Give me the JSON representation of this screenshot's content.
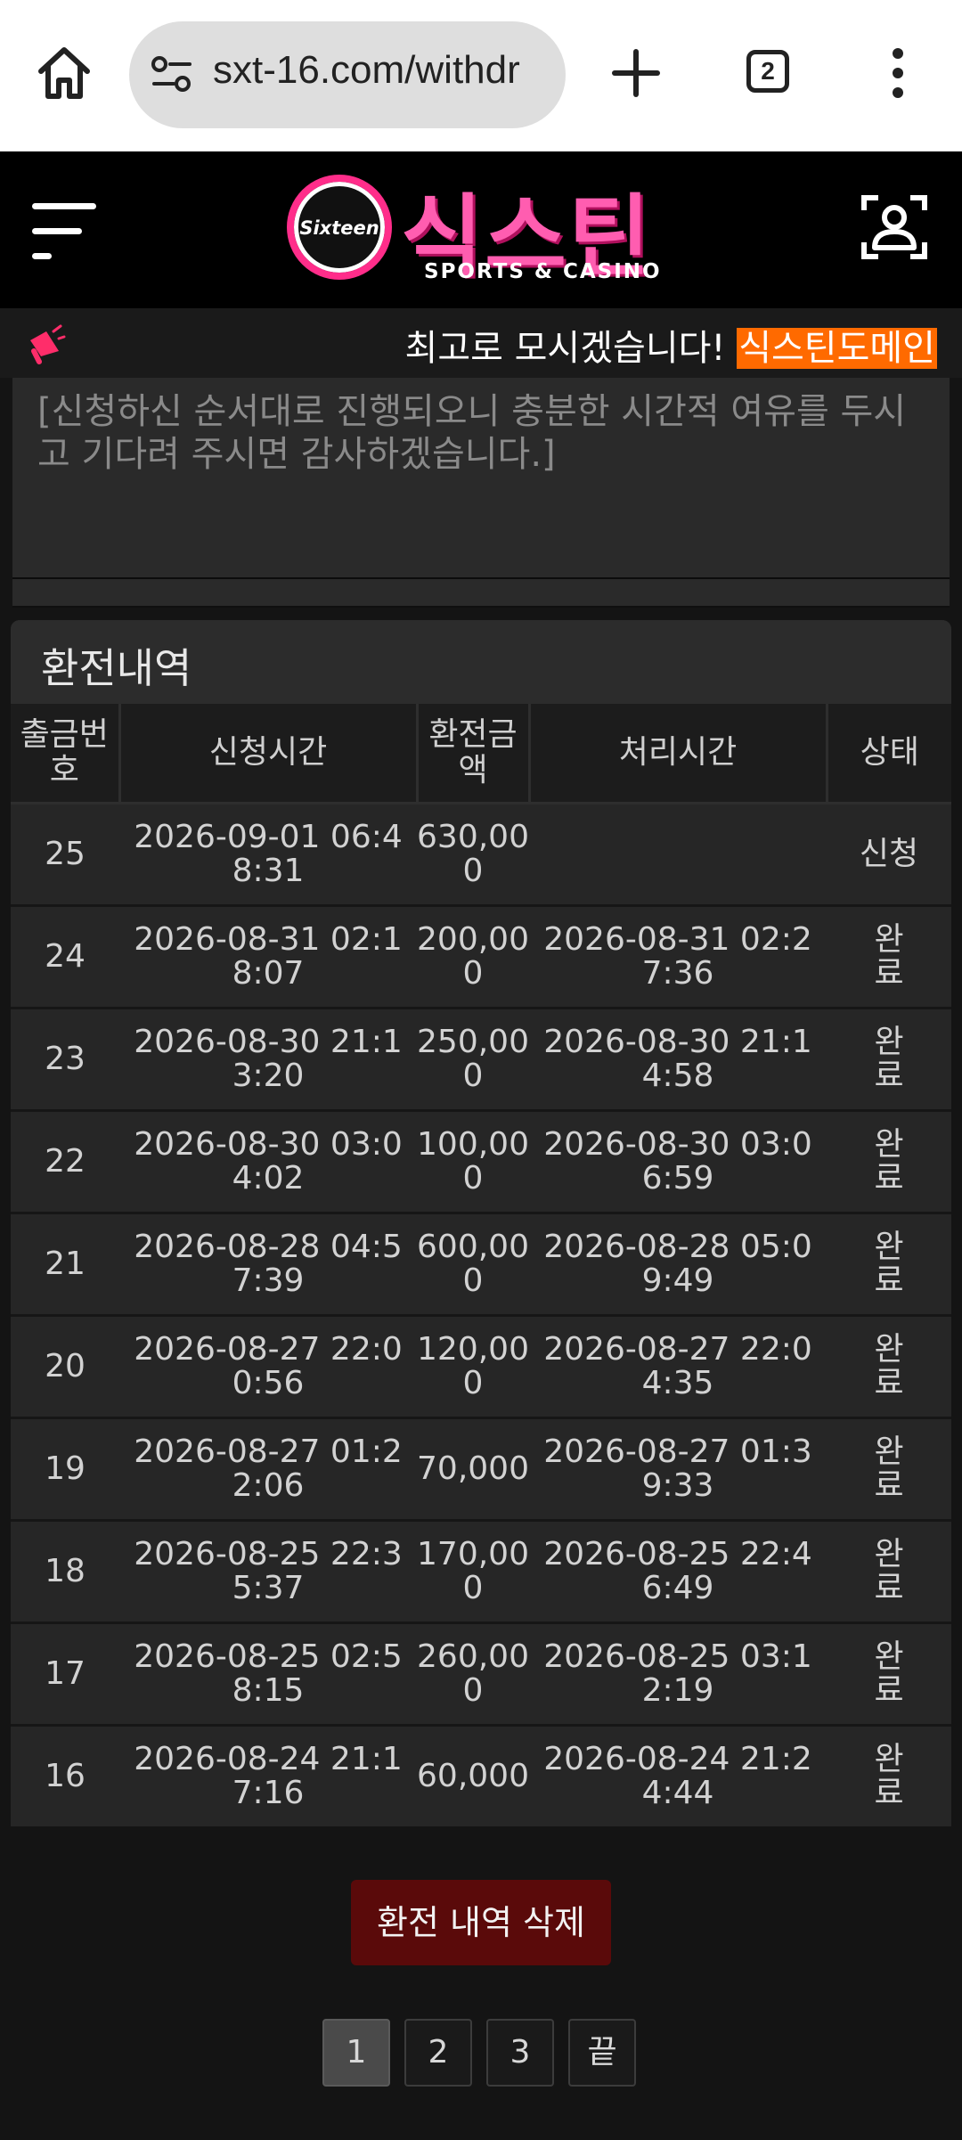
{
  "browser": {
    "url": "sxt-16.com/withdr",
    "tab_count": "2"
  },
  "header": {
    "logo_badge_text": "Sixteen",
    "logo_main_text": "식스틴",
    "logo_sub_text": "SPORTS & CASINO"
  },
  "marquee": {
    "text": "최고로 모시겠습니다! ",
    "highlight": "식스틴도메인"
  },
  "notice": {
    "text": "[신청하신 순서대로 진행되오니 충분한 시간적 여유를 두시고 기다려 주시면 감사하겠습니다.]"
  },
  "history": {
    "title": "환전내역",
    "columns": [
      "출금번호",
      "신청시간",
      "환전금액",
      "처리시간",
      "상태"
    ],
    "rows": [
      {
        "no": "25",
        "requested": "2026-09-01 06:48:31",
        "amount": "630,000",
        "processed": "",
        "status": "신청"
      },
      {
        "no": "24",
        "requested": "2026-08-31 02:18:07",
        "amount": "200,000",
        "processed": "2026-08-31 02:27:36",
        "status": "완료"
      },
      {
        "no": "23",
        "requested": "2026-08-30 21:13:20",
        "amount": "250,000",
        "processed": "2026-08-30 21:14:58",
        "status": "완료"
      },
      {
        "no": "22",
        "requested": "2026-08-30 03:04:02",
        "amount": "100,000",
        "processed": "2026-08-30 03:06:59",
        "status": "완료"
      },
      {
        "no": "21",
        "requested": "2026-08-28 04:57:39",
        "amount": "600,000",
        "processed": "2026-08-28 05:09:49",
        "status": "완료"
      },
      {
        "no": "20",
        "requested": "2026-08-27 22:00:56",
        "amount": "120,000",
        "processed": "2026-08-27 22:04:35",
        "status": "완료"
      },
      {
        "no": "19",
        "requested": "2026-08-27 01:22:06",
        "amount": "70,000",
        "processed": "2026-08-27 01:39:33",
        "status": "완료"
      },
      {
        "no": "18",
        "requested": "2026-08-25 22:35:37",
        "amount": "170,000",
        "processed": "2026-08-25 22:46:49",
        "status": "완료"
      },
      {
        "no": "17",
        "requested": "2026-08-25 02:58:15",
        "amount": "260,000",
        "processed": "2026-08-25 03:12:19",
        "status": "완료"
      },
      {
        "no": "16",
        "requested": "2026-08-24 21:17:16",
        "amount": "60,000",
        "processed": "2026-08-24 21:24:44",
        "status": "완료"
      }
    ],
    "delete_label": "환전 내역 삭제"
  },
  "pagination": {
    "pages": [
      "1",
      "2",
      "3",
      "끝"
    ],
    "current": "1"
  },
  "colors": {
    "accent_pink": "#ff5db0",
    "highlight_orange": "#ff6a00",
    "delete_red": "#5a0a0a"
  }
}
